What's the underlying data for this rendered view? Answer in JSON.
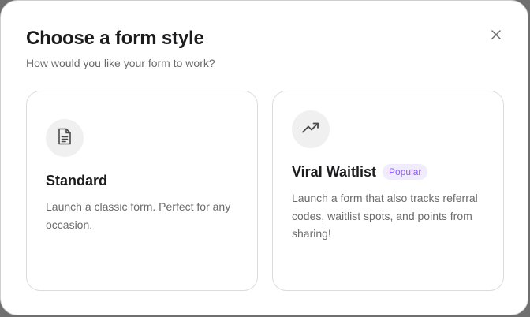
{
  "dialog": {
    "title": "Choose a form style",
    "subtitle": "How would you like your form to work?",
    "close_icon": "close-icon"
  },
  "options": [
    {
      "icon": "document-icon",
      "title": "Standard",
      "description": "Launch a classic form. Perfect for any occasion."
    },
    {
      "icon": "trending-up-icon",
      "title": "Viral Waitlist",
      "badge": "Popular",
      "description": "Launch a form that also tracks referral codes, waitlist spots, and points from sharing!"
    }
  ],
  "colors": {
    "badge_text": "#8b5cf6",
    "badge_bg": "#f1ecfd",
    "icon_bg": "#f0f0f0",
    "card_border": "#dcdcdc"
  }
}
